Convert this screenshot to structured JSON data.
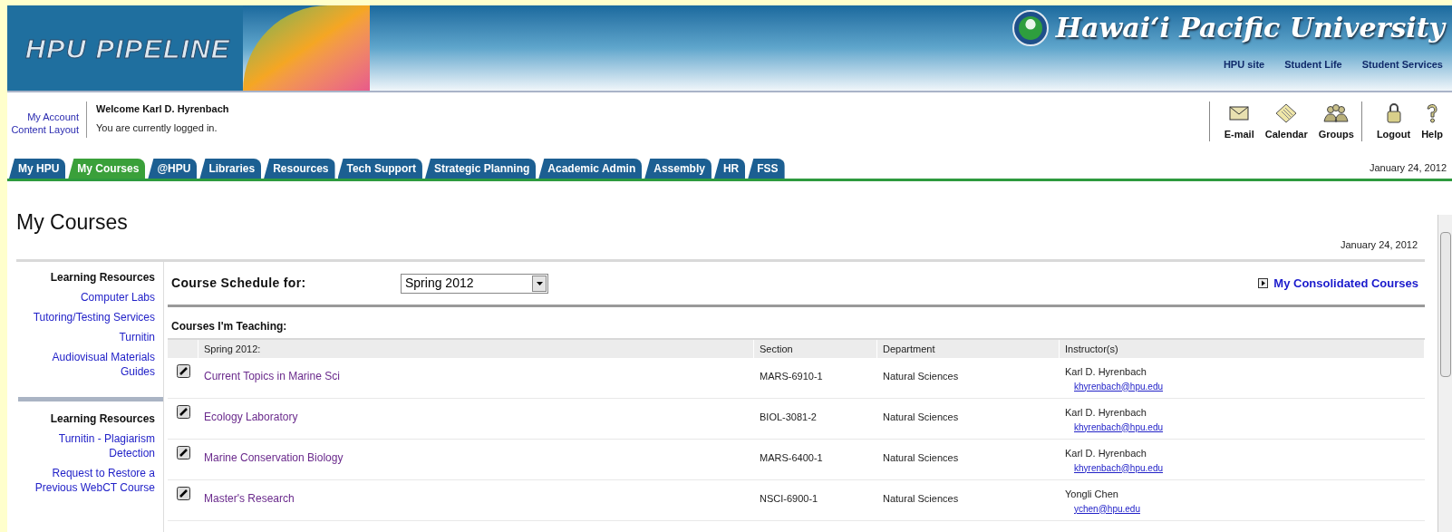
{
  "header": {
    "logo": "HPU PIPELINE",
    "university": "Hawai‘i Pacific University",
    "links": [
      "HPU site",
      "Student Life",
      "Student Services"
    ]
  },
  "account_links": [
    "My Account",
    "Content Layout"
  ],
  "welcome": {
    "title": "Welcome Karl D. Hyrenbach",
    "message": "You are currently logged in."
  },
  "toolbar_groups": [
    [
      {
        "label": "E-mail",
        "kind": "mail"
      },
      {
        "label": "Calendar",
        "kind": "calendar"
      },
      {
        "label": "Groups",
        "kind": "groups"
      }
    ],
    [
      {
        "label": "Logout",
        "kind": "logout"
      },
      {
        "label": "Help",
        "kind": "help"
      }
    ]
  ],
  "tabs": [
    {
      "label": "My HPU",
      "selected": false
    },
    {
      "label": "My Courses",
      "selected": true
    },
    {
      "label": "@HPU",
      "selected": false
    },
    {
      "label": "Libraries",
      "selected": false
    },
    {
      "label": "Resources",
      "selected": false
    },
    {
      "label": "Tech Support",
      "selected": false
    },
    {
      "label": "Strategic Planning",
      "selected": false
    },
    {
      "label": "Academic Admin",
      "selected": false
    },
    {
      "label": "Assembly",
      "selected": false
    },
    {
      "label": "HR",
      "selected": false
    },
    {
      "label": "FSS",
      "selected": false
    }
  ],
  "tab_date": "January 24, 2012",
  "page": {
    "title": "My Courses",
    "date": "January 24, 2012"
  },
  "sidebar": {
    "sections": [
      {
        "title": "Learning Resources",
        "links": [
          "Computer Labs",
          "Tutoring/Testing Services",
          "Turnitin",
          "Audiovisual Materials Guides"
        ]
      },
      {
        "title": "Learning Resources",
        "links": [
          "Turnitin - Plagiarism Detection",
          "Request to Restore a Previous WebCT Course"
        ]
      }
    ]
  },
  "schedule": {
    "label": "Course Schedule for:",
    "term": "Spring 2012",
    "consolidated_link": "My Consolidated Courses"
  },
  "teaching": {
    "title": "Courses I'm Teaching:",
    "columns": [
      "Spring 2012:",
      "Section",
      "Department",
      "Instructor(s)"
    ],
    "rows": [
      {
        "course": "Current Topics in Marine Sci",
        "section": "MARS-6910-1",
        "department": "Natural Sciences",
        "instructor": "Karl D. Hyrenbach",
        "email": "khyrenbach@hpu.edu"
      },
      {
        "course": "Ecology Laboratory",
        "section": "BIOL-3081-2",
        "department": "Natural Sciences",
        "instructor": "Karl D. Hyrenbach",
        "email": "khyrenbach@hpu.edu"
      },
      {
        "course": "Marine Conservation Biology",
        "section": "MARS-6400-1",
        "department": "Natural Sciences",
        "instructor": "Karl D. Hyrenbach",
        "email": "khyrenbach@hpu.edu"
      },
      {
        "course": "Master's Research",
        "section": "NSCI-6900-1",
        "department": "Natural Sciences",
        "instructor": "Yongli Chen",
        "email": "ychen@hpu.edu"
      }
    ]
  }
}
